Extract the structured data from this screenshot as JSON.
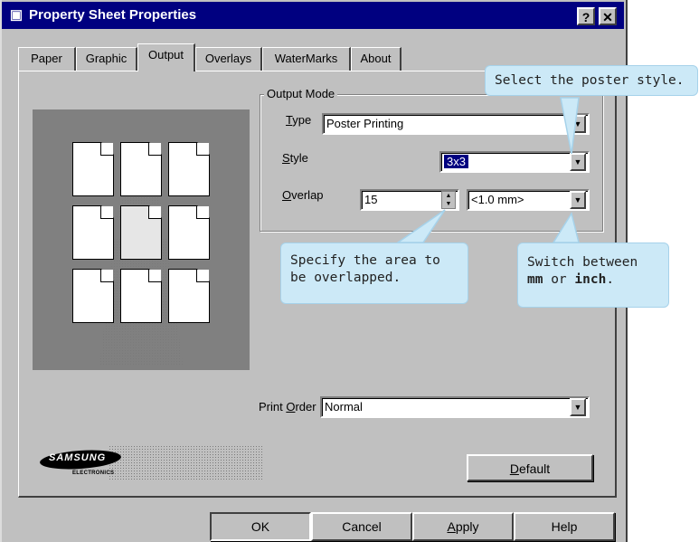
{
  "window": {
    "title": "Property Sheet Properties",
    "help_btn": "?",
    "close_btn": "✕",
    "title_icon": "printer-icon"
  },
  "tabs": [
    {
      "label": "Paper"
    },
    {
      "label": "Graphic"
    },
    {
      "label": "Output",
      "active": true
    },
    {
      "label": "Overlays"
    },
    {
      "label": "WaterMarks"
    },
    {
      "label": "About"
    }
  ],
  "output_mode": {
    "group_label": "Output Mode",
    "type_label_u": "T",
    "type_label_rest": "ype",
    "type_value": "Poster Printing",
    "style_label_u": "S",
    "style_label_rest": "tyle",
    "style_value": "3x3",
    "overlap_label_u": "O",
    "overlap_label_rest": "verlap",
    "overlap_value": "15",
    "unit_value": "<1.0 mm>"
  },
  "print_order": {
    "label_pre": "Print ",
    "label_u": "O",
    "label_rest": "rder",
    "value": "Normal"
  },
  "logo": {
    "brand": "SAMSUNG",
    "sub": "ELECTRONICS"
  },
  "buttons": {
    "default_u": "D",
    "default_rest": "efault",
    "ok": "OK",
    "cancel": "Cancel",
    "apply_u": "A",
    "apply_rest": "pply",
    "help": "Help"
  },
  "callouts": {
    "style": "Select the poster style.",
    "overlap_line1": "Specify the area to",
    "overlap_line2": "be overlapped.",
    "unit_line1": "Switch between",
    "unit_mm": "mm",
    "unit_or": " or ",
    "unit_inch": "inch",
    "unit_end": "."
  },
  "colors": {
    "title_bar": "#000080",
    "dialog_bg": "#c0c0c0",
    "callout_bg": "#cce9f7",
    "preview_bg": "#808080"
  }
}
